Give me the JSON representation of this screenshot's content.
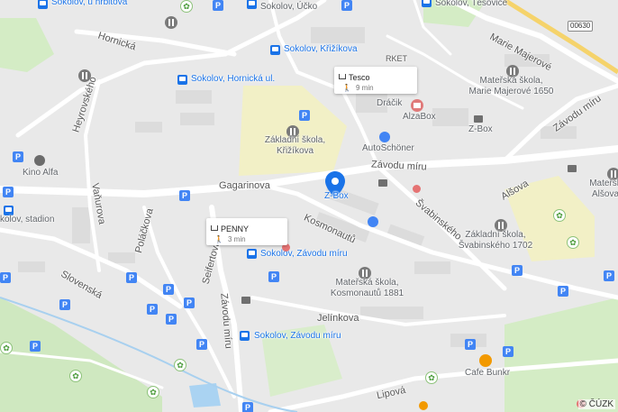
{
  "map": {
    "copyright": "© ČÚZK",
    "road_shield": "00630",
    "streets": {
      "hornicka": "Hornická",
      "heyrovskeho": "Heyrovského",
      "vanurova": "Vaňurova",
      "polackova": "Poláčkova",
      "gagarinova": "Gagarinova",
      "kosmonautu": "Kosmonautů",
      "seifertova": "Seifertova",
      "zavodu_miru_v": "Závodu míru",
      "zavodu_miru_h": "Závodu míru",
      "zavodu_miru_ne": "Závodu míru",
      "svabinskeho": "Švabinského",
      "alsova": "Alšova",
      "slovenska": "Slovenská",
      "jelinkova": "Jelínkova",
      "lipova": "Lipová",
      "marie_majerove": "Marie Majerové",
      "arket": "RKET"
    },
    "transit": {
      "hrbitov": "Sokolov, u hřbitova",
      "ucko": "Sokolov, Účko",
      "tesovice": "Sokolov, Těšovice",
      "krizikova": "Sokolov, Křižíkova",
      "hornicka": "Sokolov, Hornická ul.",
      "zavodu_miru_1": "Sokolov, Závodu míru",
      "zavodu_miru_2": "Sokolov, Závodu míru",
      "stadion": "kolov, stadion"
    },
    "pois": {
      "zs_krizikova": "Základní škola, Křižíkova",
      "ms_marie": "Mateřská škola, Marie Majerové 1650",
      "zs_svabinskeho": "Základní škola, Švabinského 1702",
      "ms_kosmonautu": "Mateřská škola, Kosmonautů 1881",
      "ms_alsova": "Mateřsk Alšova",
      "dracik": "Dráčik",
      "alzabox": "AlzaBox",
      "zbox_top": "Z-Box",
      "zbox_center": "Z-Box",
      "autoschoner": "AutoSchöner",
      "kino_alfa": "Kino Alfa",
      "cafe_bunkr": "Cafe Bunkr"
    },
    "cards": {
      "tesco": {
        "name": "Tesco",
        "time": "9 min"
      },
      "penny": {
        "name": "PENNY",
        "time": "3 min"
      }
    },
    "colors": {
      "background": "#e9e9e9",
      "road": "#ffffff",
      "park": "#d4ecc5",
      "school_area": "#f2f0c6",
      "transit_text": "#1a73e8",
      "pin": "#1a73e8"
    }
  }
}
